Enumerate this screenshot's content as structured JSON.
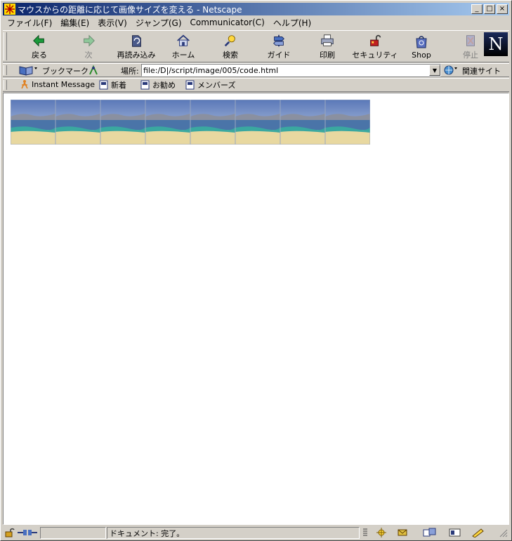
{
  "window": {
    "title": "マウスからの距離に応じて画像サイズを変える - Netscape",
    "buttons": {
      "minimize": "_",
      "maximize": "□",
      "close": "×"
    }
  },
  "menu": [
    "ファイル(F)",
    "編集(E)",
    "表示(V)",
    "ジャンプ(G)",
    "Communicator(C)",
    "ヘルプ(H)"
  ],
  "nav_buttons": [
    {
      "label": "戻る",
      "icon": "back-arrow-icon"
    },
    {
      "label": "次",
      "icon": "forward-arrow-icon"
    },
    {
      "label": "再読み込み",
      "icon": "reload-icon"
    },
    {
      "label": "ホーム",
      "icon": "home-icon"
    },
    {
      "label": "検索",
      "icon": "search-icon"
    },
    {
      "label": "ガイド",
      "icon": "guide-icon"
    },
    {
      "label": "印刷",
      "icon": "print-icon"
    },
    {
      "label": "セキュリティ",
      "icon": "security-lock-icon"
    },
    {
      "label": "Shop",
      "icon": "shop-bag-icon"
    },
    {
      "label": "停止",
      "icon": "stop-icon"
    }
  ],
  "location": {
    "bookmarks_label": "ブックマーク",
    "location_label": "場所:",
    "url": "file:/D|/script/image/005/code.html",
    "related_label": "関連サイト"
  },
  "personal_toolbar": [
    "Instant Message",
    "新着",
    "お勧め",
    "メンバーズ"
  ],
  "content": {
    "thumbnail_count": 8
  },
  "status": {
    "text": "ドキュメント: 完了。"
  }
}
